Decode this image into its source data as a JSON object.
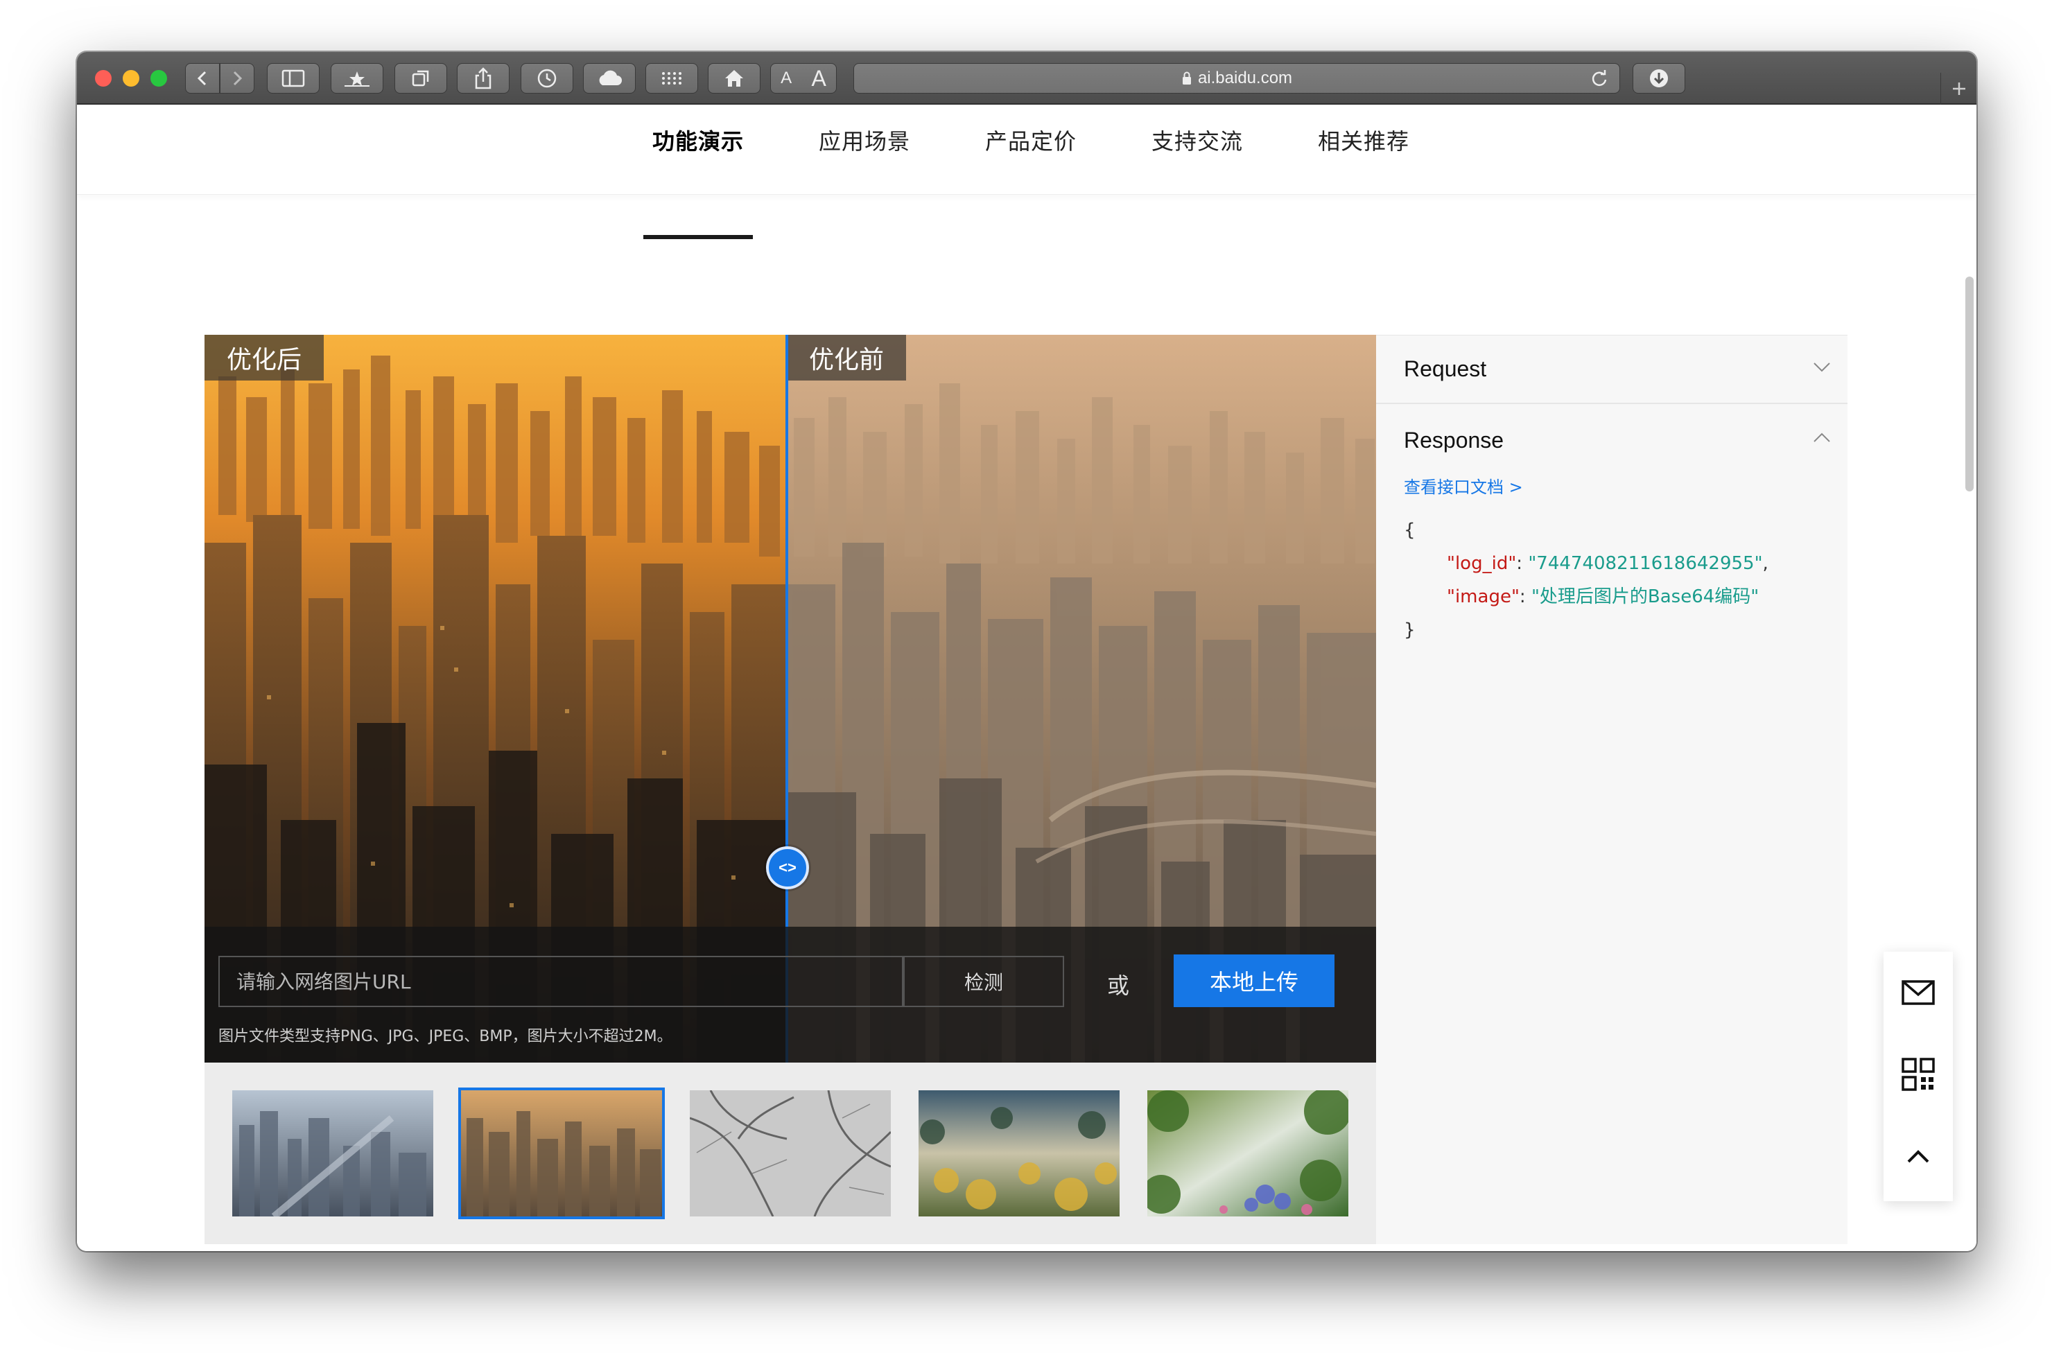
{
  "browser": {
    "url": "ai.baidu.com",
    "font_small": "A",
    "font_large": "A"
  },
  "nav": {
    "items": [
      {
        "label": "功能演示",
        "active": true
      },
      {
        "label": "应用场景",
        "active": false
      },
      {
        "label": "产品定价",
        "active": false
      },
      {
        "label": "支持交流",
        "active": false
      },
      {
        "label": "相关推荐",
        "active": false
      }
    ]
  },
  "demo": {
    "label_after": "优化后",
    "label_before": "优化前",
    "handle_glyph": "<>",
    "url_placeholder": "请输入网络图片URL",
    "detect_label": "检测",
    "or_label": "或",
    "upload_label": "本地上传",
    "hint": "图片文件类型支持PNG、JPG、JPEG、BMP，图片大小不超过2M。",
    "thumbnails": [
      {
        "name": "city-blue-haze",
        "selected": false
      },
      {
        "name": "city-orange-haze",
        "selected": true
      },
      {
        "name": "foggy-trees",
        "selected": false
      },
      {
        "name": "misty-forest",
        "selected": false
      },
      {
        "name": "garden-mist",
        "selected": false
      }
    ]
  },
  "panel": {
    "request_label": "Request",
    "response_label": "Response",
    "doc_link": "查看接口文档 >",
    "json": {
      "open": "{",
      "close": "}",
      "log_id_key": "\"log_id\"",
      "log_id_value": "\"7447408211618642955\"",
      "image_key": "\"image\"",
      "image_value": "\"处理后图片的Base64编码\"",
      "colon": ": ",
      "comma": ","
    }
  },
  "colors": {
    "accent": "#1677e6",
    "json_key": "#c41a16",
    "json_value": "#1a9c8c"
  },
  "float_icons": [
    "mail-icon",
    "qr-code-icon",
    "chevron-up-icon"
  ]
}
